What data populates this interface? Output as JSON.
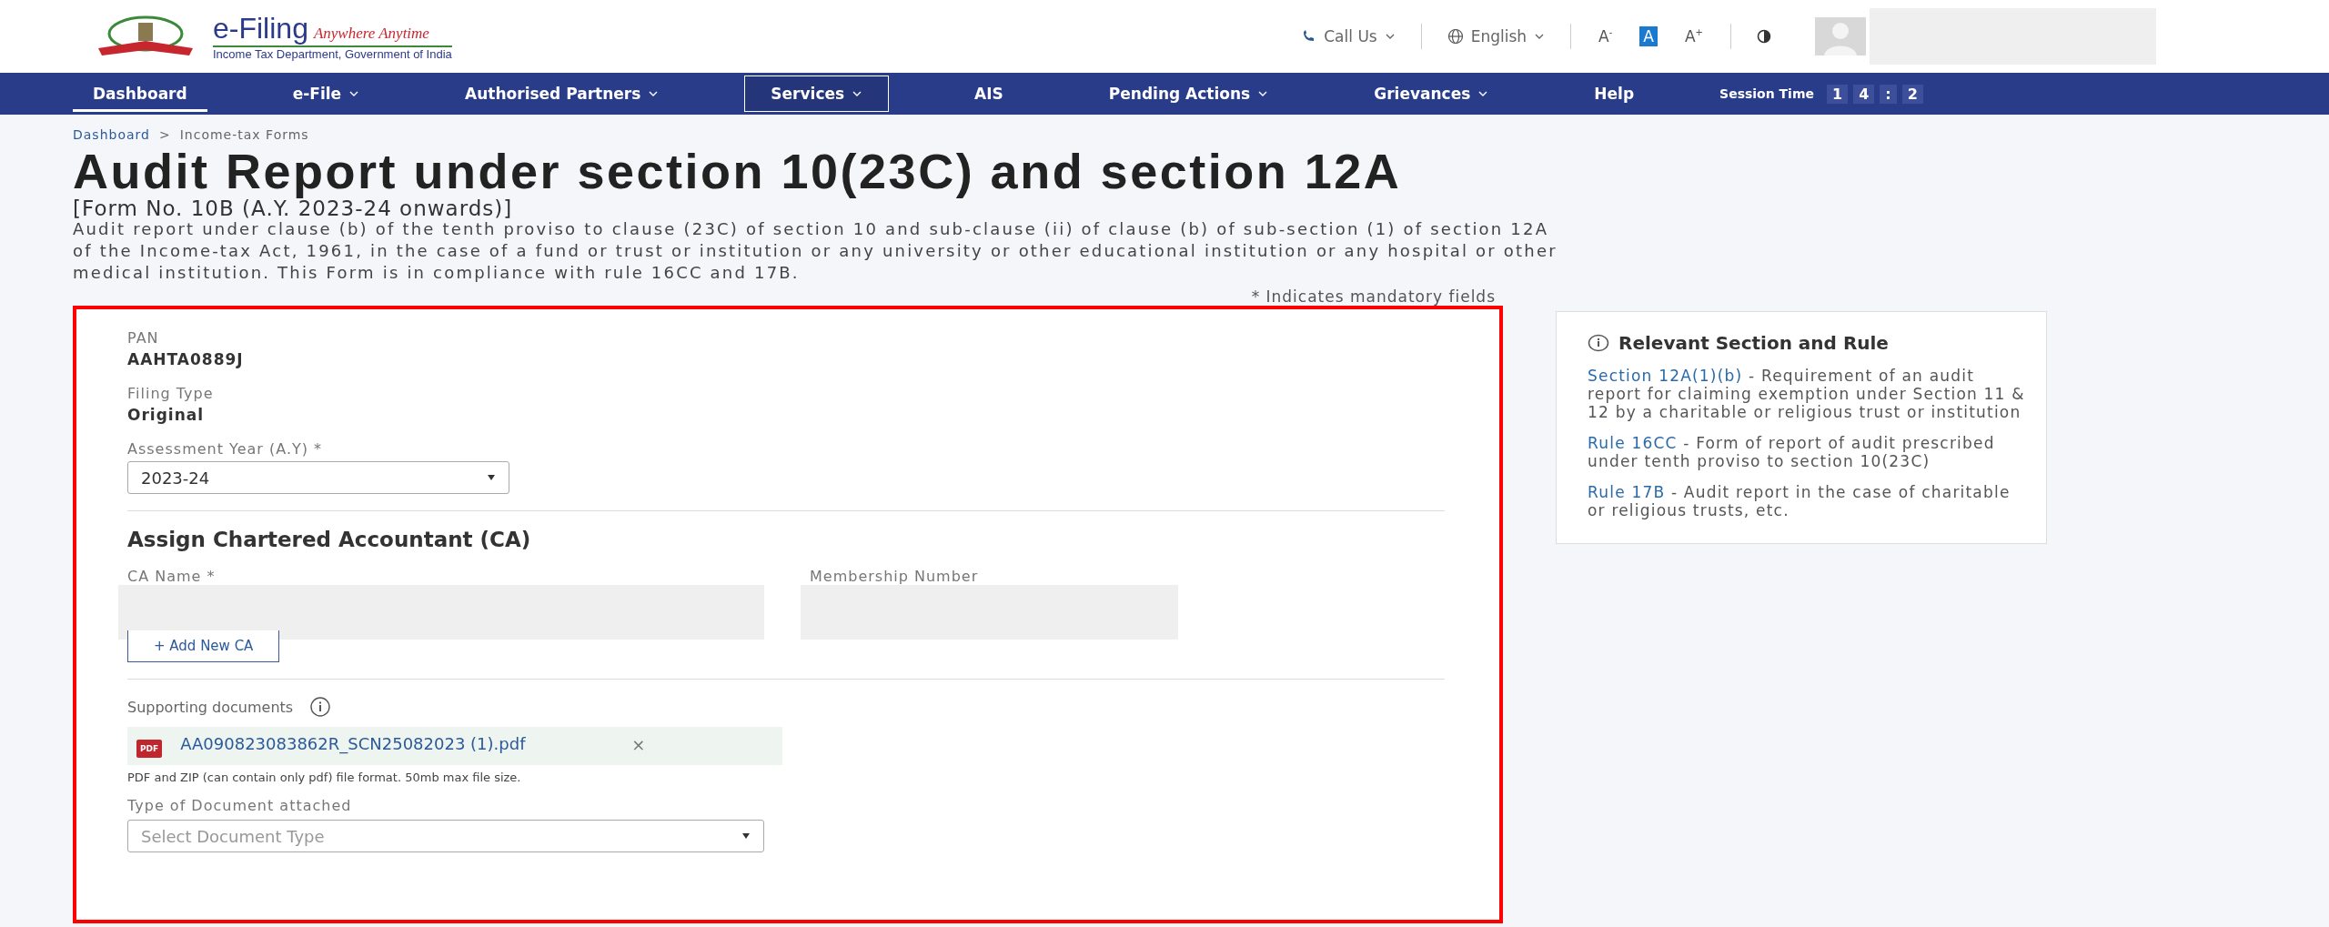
{
  "header": {
    "logo_title": "e-Filing",
    "logo_tagline": "Anywhere Anytime",
    "logo_subtitle": "Income Tax Department, Government of India",
    "call_us": "Call Us",
    "language": "English",
    "font_sizes": [
      {
        "label": "A$^{-}$",
        "selected": false
      },
      {
        "label": "A",
        "selected": true
      },
      {
        "label": "A$^{+}$",
        "selected": false
      }
    ]
  },
  "nav": {
    "items": [
      {
        "label": "Dashboard",
        "has_menu": false,
        "selected": true,
        "focused": false
      },
      {
        "label": "e-File",
        "has_menu": true,
        "selected": false,
        "focused": false
      },
      {
        "label": "Authorised Partners",
        "has_menu": true,
        "selected": false,
        "focused": false
      },
      {
        "label": "Services",
        "has_menu": true,
        "selected": false,
        "focused": true
      },
      {
        "label": "AIS",
        "has_menu": false,
        "selected": false,
        "focused": false
      },
      {
        "label": "Pending Actions",
        "has_menu": true,
        "selected": false,
        "focused": false
      },
      {
        "label": "Grievances",
        "has_menu": true,
        "selected": false,
        "focused": false
      },
      {
        "label": "Help",
        "has_menu": false,
        "selected": false,
        "focused": false
      }
    ],
    "session_label": "Session Time",
    "session_digits": [
      "1",
      "4",
      ":",
      "2"
    ]
  },
  "breadcrumb": [
    {
      "label": "Dashboard",
      "link": true
    },
    {
      "separator": ">",
      "label": "Income-tax Forms",
      "link": false
    }
  ],
  "page": {
    "title": "Audit Report under section 10(23C) and section 12A",
    "form_no": "[Form No. 10B (A.Y. 2023-24 onwards)]",
    "description": "Audit report under clause (b) of the tenth proviso to clause (23C) of section 10 and sub-clause (ii) of clause (b) of sub-section (1) of section 12A of the Income-tax Act, 1961, in the case of a fund or trust or institution or any university or other educational institution or any hospital or other medical institution. This Form is in compliance with rule 16CC and 17B.",
    "mandatory_note": "* Indicates mandatory fields"
  },
  "form": {
    "pan": {
      "label": "PAN",
      "value": "AAHTA0889J"
    },
    "filing_type": {
      "label": "Filing Type",
      "value": "Original"
    },
    "assessment_year": {
      "label": "Assessment Year (A.Y) *",
      "value": "2023-24"
    },
    "ca_section": {
      "heading": "Assign Chartered Accountant (CA)",
      "ca_name_label": "CA Name *",
      "membership_label": "Membership Number",
      "add_button": "+ Add New CA"
    },
    "documents": {
      "label": "Supporting documents",
      "file_name": "AA090823083862R_SCN25082023 (1).pdf",
      "file_badge": "PDF",
      "remove": "×",
      "hint": "PDF and ZIP (can contain only pdf) file format. 50mb max file size.",
      "type_label": "Type of Document attached",
      "type_placeholder": "Select Document Type"
    }
  },
  "side_panel": {
    "title": "Relevant Section and Rule",
    "items": [
      {
        "link": "Section 12A(1)(b)",
        "text": " - Requirement of an audit report for claiming exemption under Section 11 & 12 by a charitable or religious trust or institution"
      },
      {
        "link": "Rule 16CC",
        "text": " - Form of report of audit prescribed under tenth proviso to section 10(23C)"
      },
      {
        "link": "Rule 17B",
        "text": " - Audit report in the case of charitable or religious trusts, etc."
      }
    ]
  }
}
